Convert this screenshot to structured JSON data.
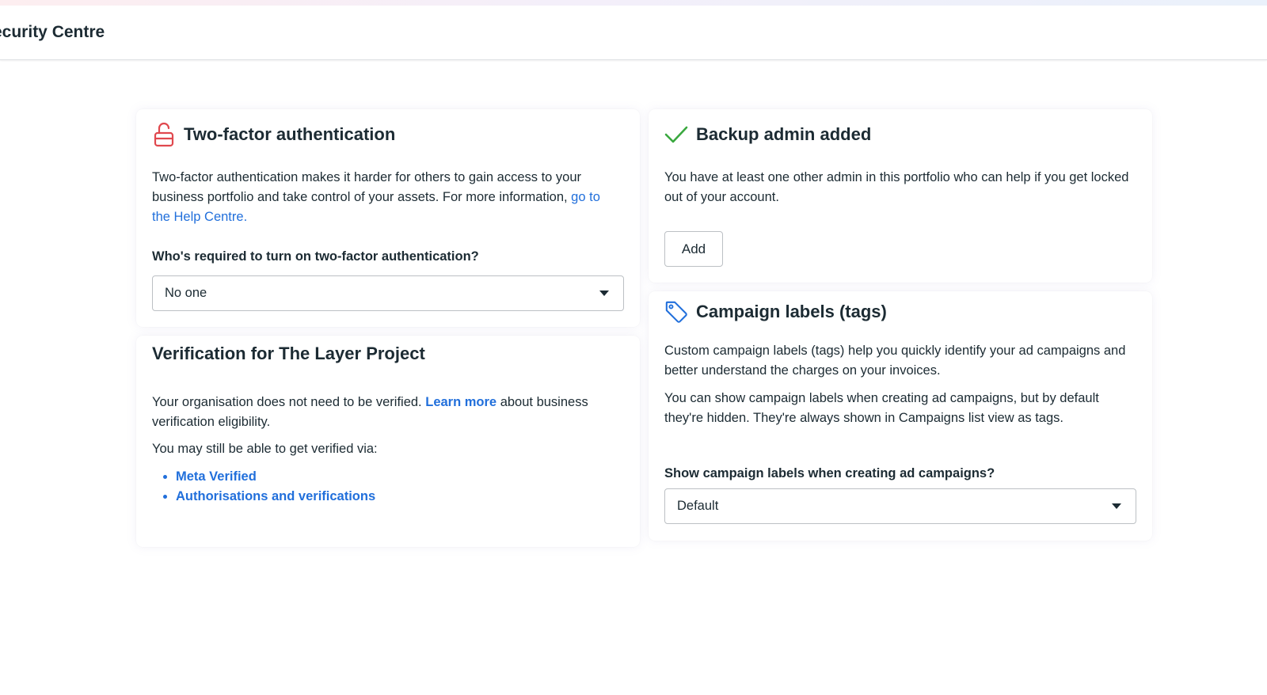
{
  "header": {
    "title": "ecurity Centre"
  },
  "two_factor": {
    "icon": "unlocked-padlock-icon",
    "icon_color": "#e0484e",
    "title": "Two-factor authentication",
    "description_part1": "Two-factor authentication makes it harder for others to gain access to your business portfolio and take control of your assets. For more information, ",
    "help_link": "go to the Help Centre.",
    "question": "Who's required to turn on two-factor authentication?",
    "select_value": "No one"
  },
  "verification": {
    "title": "Verification for The Layer Project",
    "text_part1": "Your organisation does not need to be verified. ",
    "learn_more_link": "Learn more",
    "text_part2": " about business verification eligibility.",
    "still_text": "You may still be able to get verified via:",
    "options": [
      "Meta Verified",
      "Authorisations and verifications"
    ]
  },
  "backup_admin": {
    "icon": "checkmark-icon",
    "icon_color": "#3aa83f",
    "title": "Backup admin added",
    "description": "You have at least one other admin in this portfolio who can help if you get locked out of your account.",
    "add_button": "Add"
  },
  "campaign_labels": {
    "icon": "tag-icon",
    "icon_color": "#216fdb",
    "title": "Campaign labels (tags)",
    "paragraph1": "Custom campaign labels (tags) help you quickly identify your ad campaigns and better understand the charges on your invoices.",
    "paragraph2": "You can show campaign labels when creating ad campaigns, but by default they're hidden. They're always shown in Campaigns list view as tags.",
    "question": "Show campaign labels when creating ad campaigns?",
    "select_value": "Default"
  },
  "colors": {
    "link": "#216fdb",
    "text": "#1c2b33",
    "border": "#bcc0c4"
  }
}
